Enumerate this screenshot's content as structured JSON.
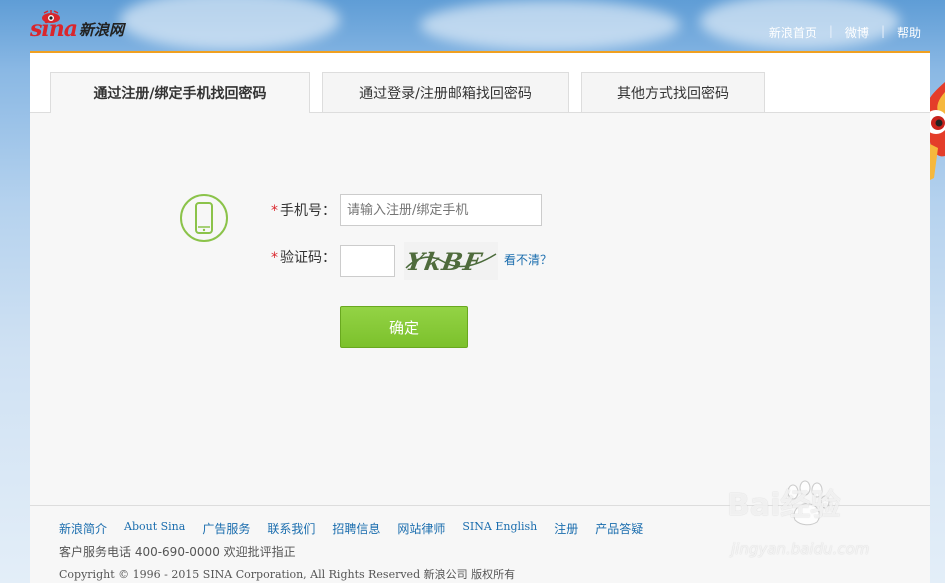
{
  "header": {
    "logo_text": "sina",
    "logo_cn": "新浪网",
    "links": [
      "新浪首页",
      "微博",
      "帮助"
    ]
  },
  "tabs": [
    {
      "label": "通过注册/绑定手机找回密码",
      "active": true
    },
    {
      "label": "通过登录/注册邮箱找回密码",
      "active": false
    },
    {
      "label": "其他方式找回密码",
      "active": false
    }
  ],
  "form": {
    "required_mark": "*",
    "phone_label": "手机号：",
    "phone_placeholder": "请输入注册/绑定手机",
    "code_label": "验证码：",
    "captcha_text": "YkBF",
    "refresh_link": "看不清？",
    "submit_label": "确定"
  },
  "footer": {
    "links": [
      "新浪简介",
      "About Sina",
      "广告服务",
      "联系我们",
      "招聘信息",
      "网站律师",
      "SINA English",
      "注册",
      "产品答疑"
    ],
    "service": "客户服务电话 400-690-0000 欢迎批评指正",
    "copyright": "Copyright © 1996 - 2015 SINA Corporation, All Rights Reserved 新浪公司 版权所有"
  },
  "watermark": {
    "text": "Bai经验",
    "url": "jingyan.baidu.com"
  },
  "colors": {
    "accent_orange": "#f0a020",
    "brand_red": "#d9262c",
    "button_green": "#7cc12c",
    "link_blue": "#1a6dae"
  }
}
